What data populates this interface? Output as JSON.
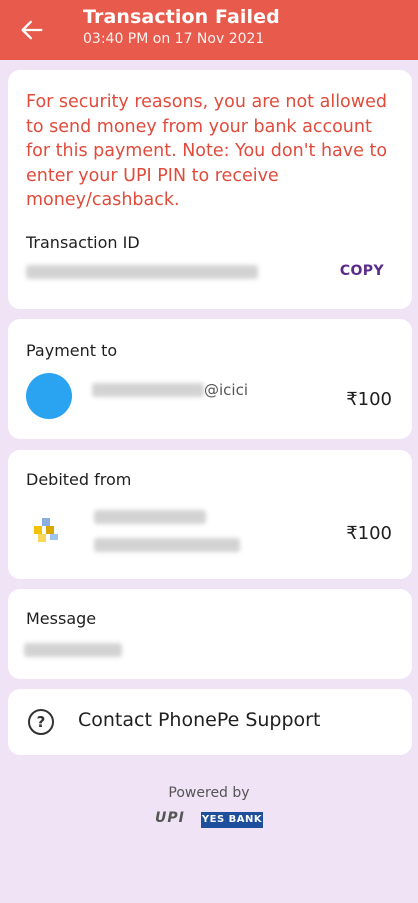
{
  "header": {
    "title": "Transaction Failed",
    "subtitle": "03:40 PM on 17 Nov 2021",
    "bg": "#e85a4b"
  },
  "message_card": {
    "warning": "For security reasons, you are not allowed to send money from your bank account for this payment. Note: You don't have to enter your UPI PIN to receive money/cashback.",
    "transaction_id_label": "Transaction ID",
    "copy_label": "COPY"
  },
  "payment_to": {
    "label": "Payment to",
    "handle_suffix": "@icici",
    "amount": "₹100"
  },
  "debited_from": {
    "label": "Debited from",
    "amount": "₹100"
  },
  "message": {
    "label": "Message"
  },
  "support": {
    "label": "Contact PhonePe Support",
    "icon": "help-icon"
  },
  "footer": {
    "powered_by": "Powered by",
    "upi": "UPI",
    "bank": "YES BANK"
  }
}
